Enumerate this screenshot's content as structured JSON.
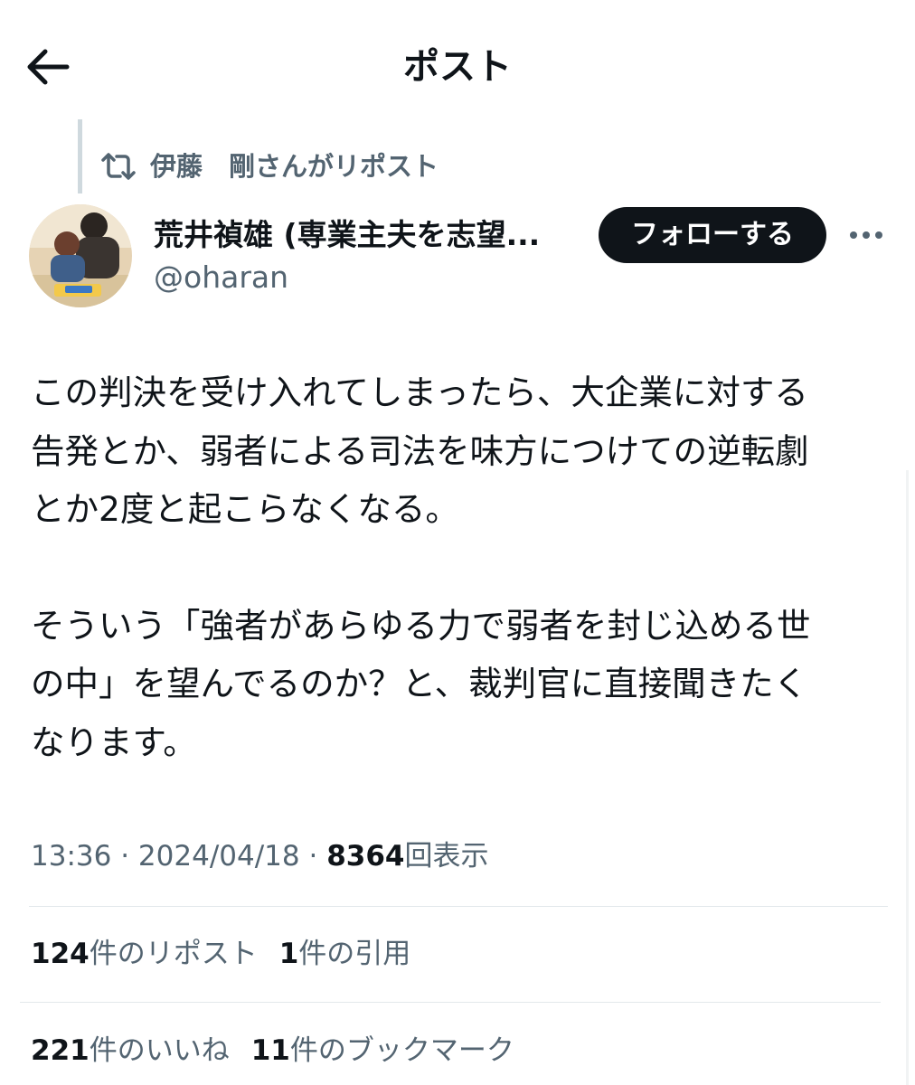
{
  "header": {
    "title": "ポスト"
  },
  "repost": {
    "text": "伊藤　剛さんがリポスト"
  },
  "author": {
    "name": "荒井禎雄 (専業主夫を志望...",
    "handle": "@oharan"
  },
  "actions": {
    "follow_label": "フォローする"
  },
  "post": {
    "lines": [
      "この判決を受け入れてしまったら、大企業に対する",
      "告発とか、弱者による司法を味方につけての逆転劇",
      "とか2度と起こらなくなる。",
      "そういう「強者があらゆる力で弱者を封じ込める世",
      "の中」を望んでるのか？と、裁判官に直接聞きたく",
      "なります。"
    ]
  },
  "meta": {
    "time": "13:36",
    "separator": "·",
    "date": "2024/04/18",
    "views": "8364",
    "views_label": "回表示"
  },
  "stats": {
    "reposts": "124",
    "reposts_label": "件のリポスト",
    "quotes": "1",
    "quotes_label": "件の引用",
    "likes": "221",
    "likes_label": "件のいいね",
    "bookmarks": "11",
    "bookmarks_label": "件のブックマーク"
  },
  "icons": {
    "back": "arrow-left-icon",
    "repost": "repost-icon",
    "more": "more-dots-icon"
  }
}
